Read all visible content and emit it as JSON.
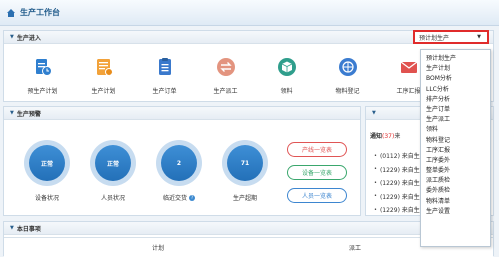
{
  "title": "生产工作台",
  "entry": {
    "heading": "生产进入",
    "items": [
      {
        "label": "预生产计划",
        "icon": "doc-clock-icon",
        "color": "#2f7fcf"
      },
      {
        "label": "生产计划",
        "icon": "plan-list-icon",
        "color": "#f2a23a"
      },
      {
        "label": "生产订单",
        "icon": "order-icon",
        "color": "#3a79cc"
      },
      {
        "label": "生产派工",
        "icon": "dispatch-arrows-icon",
        "color": "#e3947f"
      },
      {
        "label": "领料",
        "icon": "box-icon",
        "color": "#2f9e8c"
      },
      {
        "label": "物料登记",
        "icon": "globe-icon",
        "color": "#3b7cd0"
      },
      {
        "label": "工序汇报",
        "icon": "mail-icon",
        "color": "#e0524f"
      }
    ]
  },
  "selector": {
    "value": "预计划生产"
  },
  "dropdown": {
    "options": [
      "预计划生产",
      "生产计划",
      "BOM分析",
      "LLC分析",
      "排产分析",
      "生产订单",
      "生产派工",
      "领料",
      "物料登记",
      "工序汇报",
      "工序委外",
      "整单委外",
      "派工质检",
      "委外质检",
      "物料清单",
      "生产设置"
    ]
  },
  "warning": {
    "heading": "生产预警",
    "circles": [
      {
        "value": "正常",
        "label": "设备状况"
      },
      {
        "value": "正常",
        "label": "人员状况"
      },
      {
        "value": "2",
        "label": "临近交货",
        "has_help": true
      },
      {
        "value": "71",
        "label": "生产超期"
      }
    ],
    "buttons": [
      {
        "label": "产线一览表",
        "color": "#e05555"
      },
      {
        "label": "设备一览表",
        "color": "#3aa76d"
      },
      {
        "label": "人员一览表",
        "color": "#3d86d0"
      }
    ]
  },
  "notice": {
    "tab_label": "通知",
    "tab_count": "(37)",
    "tab_suffix": "来",
    "items": [
      "(0112) 来自生",
      "(1229) 来自生",
      "(1229) 来自生",
      "(1229) 来自生",
      "(1229) 来自生"
    ]
  },
  "today": {
    "heading": "本日事项",
    "columns": [
      "计划",
      "派工"
    ]
  }
}
